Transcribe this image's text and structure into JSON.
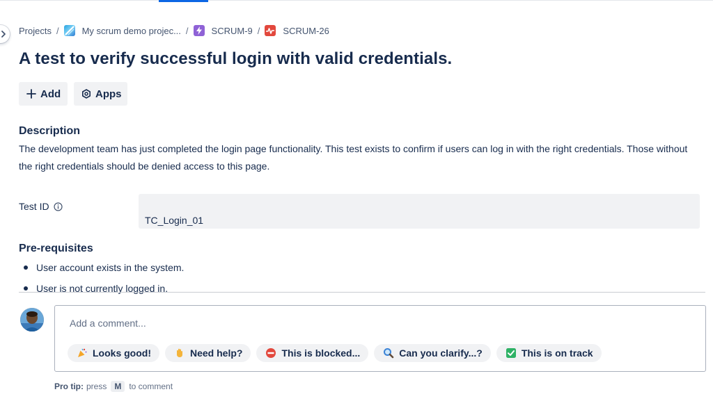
{
  "breadcrumb": {
    "projects": "Projects",
    "project": "My scrum demo projec...",
    "epic": "SCRUM-9",
    "issue": "SCRUM-26",
    "separator": "/"
  },
  "issue": {
    "title": "A test to verify successful login with valid credentials."
  },
  "actions": {
    "add": "Add",
    "apps": "Apps"
  },
  "description": {
    "heading": "Description",
    "text": "The development team has just completed the login page functionality. This test exists to confirm if users can log in with the right credentials. Those without the right credentials should be denied access to this page."
  },
  "fields": {
    "test_id_label": "Test ID",
    "test_id_value": "TC_Login_01"
  },
  "prerequisites": {
    "heading": "Pre-requisites",
    "items": [
      "User account exists in the system.",
      "User is not currently logged in."
    ]
  },
  "comment": {
    "placeholder": "Add a comment...",
    "quick_replies": [
      {
        "label": "Looks good!",
        "icon": "party-popper-icon"
      },
      {
        "label": "Need help?",
        "icon": "waving-hand-icon"
      },
      {
        "label": "This is blocked...",
        "icon": "no-entry-icon"
      },
      {
        "label": "Can you clarify...?",
        "icon": "magnifier-icon"
      },
      {
        "label": "This is on track",
        "icon": "check-mark-icon"
      }
    ]
  },
  "pro_tip": {
    "label": "Pro tip:",
    "before": "press",
    "key": "M",
    "after": "to comment"
  },
  "colors": {
    "accent": "#0c66e4",
    "epic": "#8f62d6",
    "test_issue": "#e2483d",
    "text": "#172b4d"
  }
}
